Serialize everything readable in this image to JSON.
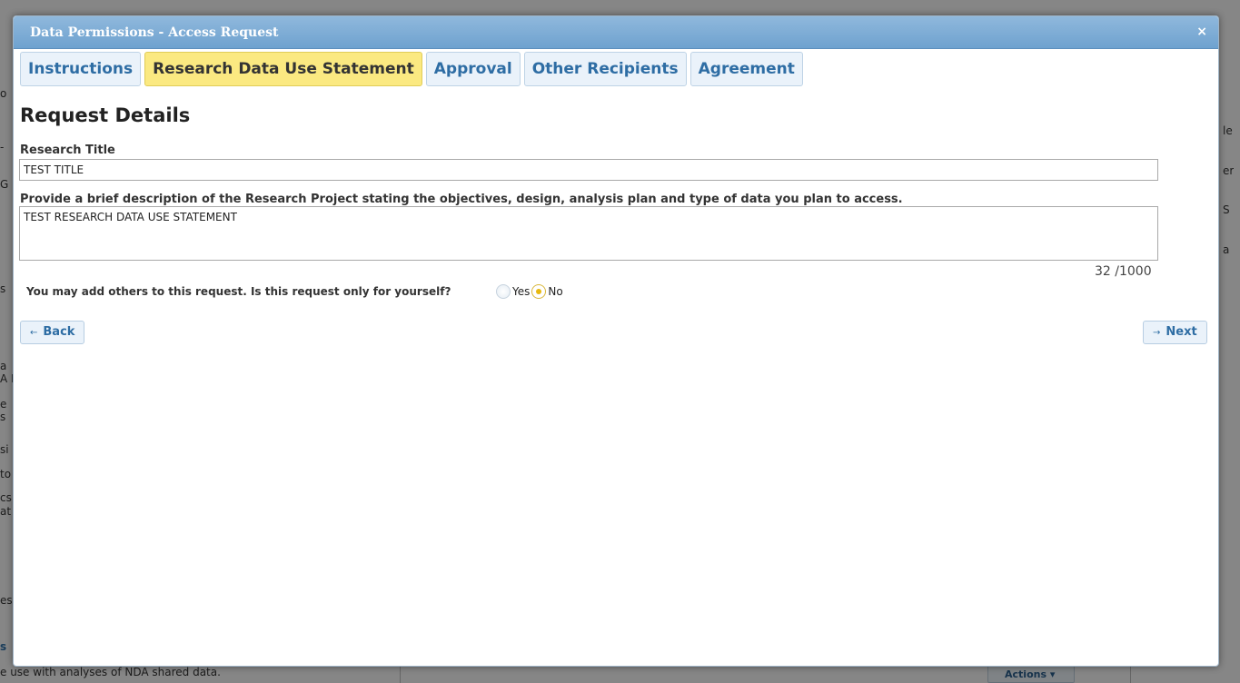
{
  "background": {
    "bottom_text": "e use with analyses of NDA shared data.",
    "actions_label": "Actions",
    "fragments_left": [
      "o",
      "-",
      "G",
      "s",
      "a",
      "A I",
      "e",
      "s",
      "si",
      "to",
      "cs",
      "at",
      "es",
      "s"
    ],
    "fragments_right": [
      "le",
      "er",
      "S",
      "a"
    ]
  },
  "modal": {
    "title": "Data Permissions - Access Request",
    "close_glyph": "×",
    "tabs": [
      {
        "label": "Instructions",
        "active": false
      },
      {
        "label": "Research Data Use Statement",
        "active": true
      },
      {
        "label": "Approval",
        "active": false
      },
      {
        "label": "Other Recipients",
        "active": false
      },
      {
        "label": "Agreement",
        "active": false
      }
    ],
    "section_title": "Request Details",
    "research_title": {
      "label": "Research Title",
      "value": "TEST TITLE"
    },
    "description": {
      "label": "Provide a brief description of the Research Project stating the objectives, design, analysis plan and type of data you plan to access.",
      "value": "TEST RESEARCH DATA USE STATEMENT",
      "char_count": "32 /1000"
    },
    "self_only": {
      "question": "You may add others to this request. Is this request only for yourself?",
      "options": [
        {
          "label": "Yes",
          "checked": false
        },
        {
          "label": "No",
          "checked": true
        }
      ]
    },
    "back_button": {
      "label": "Back",
      "arrow": "←"
    },
    "next_button": {
      "label": "Next",
      "arrow": "→"
    }
  },
  "colors": {
    "header": "#7aa9d4",
    "active_tab": "#fbe981",
    "tab_text": "#2e6da4"
  }
}
